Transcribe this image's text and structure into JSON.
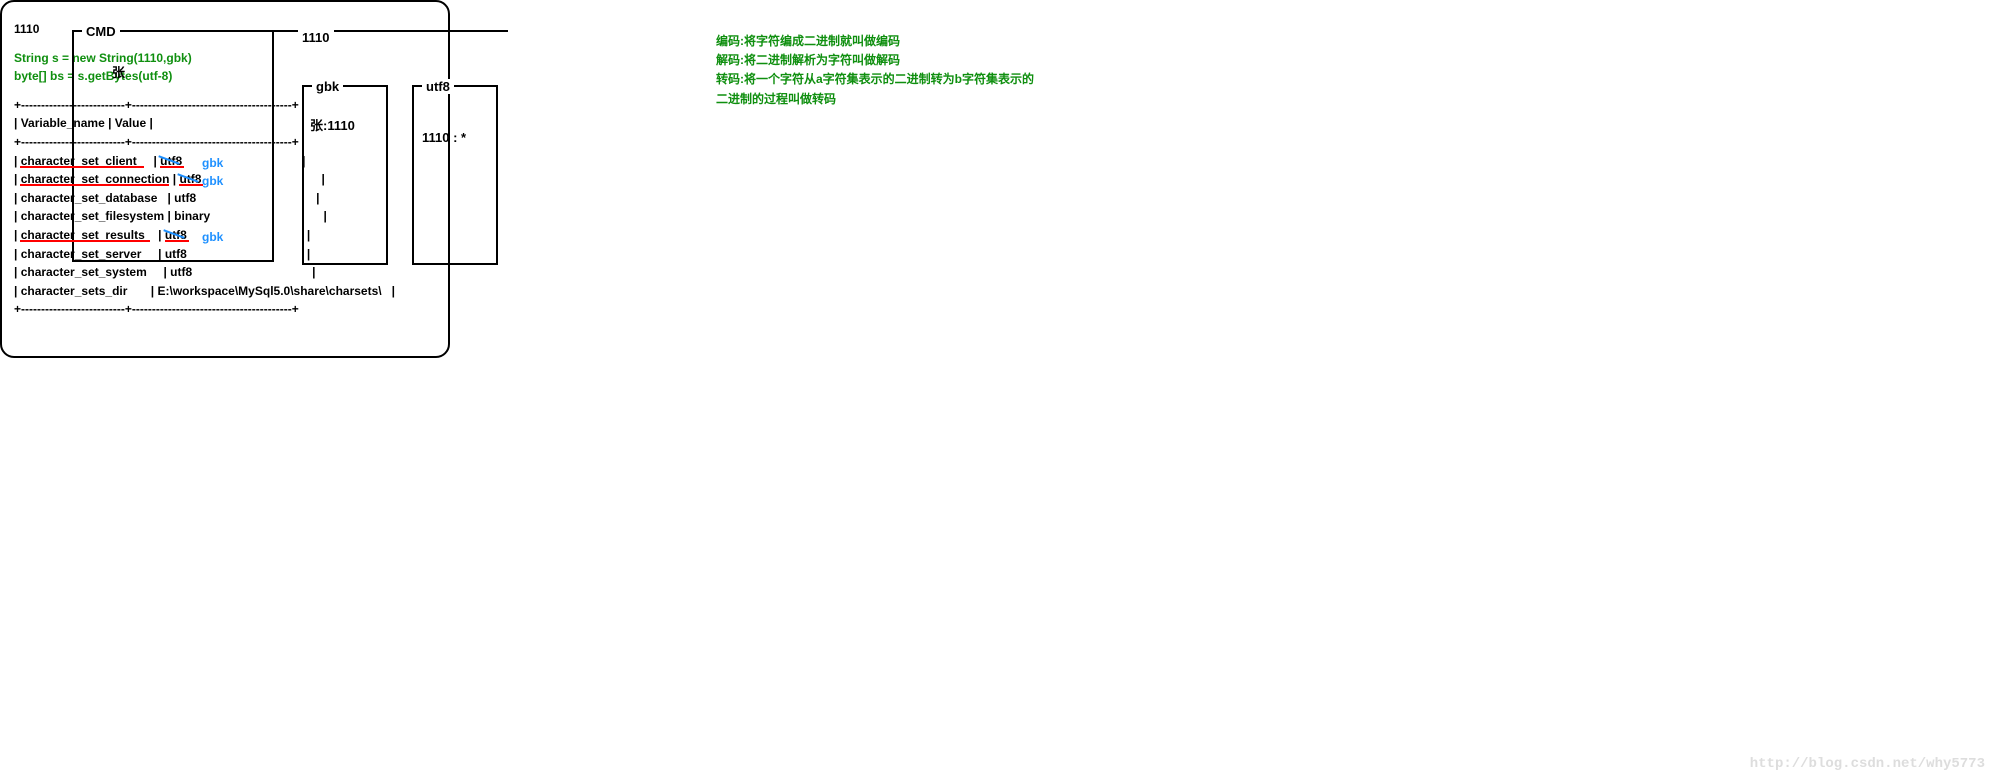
{
  "cmd": {
    "label": "CMD",
    "content": "张"
  },
  "line_label": "1110",
  "gbk": {
    "label": "gbk",
    "content": "张:1110"
  },
  "utf8": {
    "label": "utf8",
    "content": "1110 : *"
  },
  "mainbox": {
    "top_value": "1110",
    "code1": "String s = new String(1110,gbk)",
    "code2": "byte[] bs = s.getBytes(utf-8)"
  },
  "definitions": {
    "encoding": "编码:将字符编成二进制就叫做编码",
    "decoding": "解码:将二进制解析为字符叫做解码",
    "transcoding1": "转码:将一个字符从a字符集表示的二进制转为b字符集表示的",
    "transcoding2": "二进制的过程叫做转码"
  },
  "table": {
    "sep": "+--------------------------+----------------------------------------+",
    "header": "| Variable_name            | Value                                         |",
    "rows": [
      {
        "var": "character_set_client",
        "val": "utf8",
        "annot": "gbk",
        "underline": true,
        "strike": true
      },
      {
        "var": "character_set_connection",
        "val": "utf8",
        "annot": "gbk",
        "underline": true,
        "strike": true
      },
      {
        "var": "character_set_database",
        "val": "utf8"
      },
      {
        "var": "character_set_filesystem",
        "val": "binary"
      },
      {
        "var": "character_set_results",
        "val": "utf8",
        "annot": "gbk",
        "underline": true,
        "strike": true
      },
      {
        "var": "character_set_server",
        "val": "utf8"
      },
      {
        "var": "character_set_system",
        "val": "utf8"
      },
      {
        "var": "character_sets_dir",
        "val": "E:\\workspace\\MySql5.0\\share\\charsets\\"
      }
    ]
  },
  "watermark": "http://blog.csdn.net/why5773"
}
